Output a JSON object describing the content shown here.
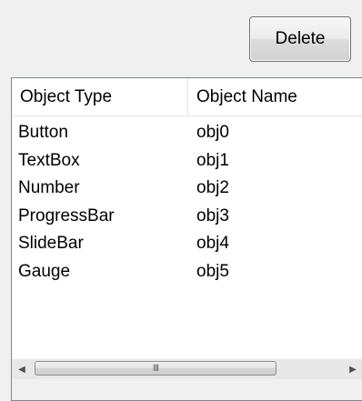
{
  "toolbar": {
    "delete_label": "Delete"
  },
  "listview": {
    "columns": [
      "Object Type",
      "Object Name"
    ],
    "rows": [
      [
        "Button",
        "obj0"
      ],
      [
        "TextBox",
        "obj1"
      ],
      [
        "Number",
        "obj2"
      ],
      [
        "ProgressBar",
        "obj3"
      ],
      [
        "SlideBar",
        "obj4"
      ],
      [
        "Gauge",
        "obj5"
      ]
    ]
  },
  "scrollbar": {
    "grip_glyph": "III",
    "left_arrow": "◀",
    "right_arrow": "▶"
  }
}
